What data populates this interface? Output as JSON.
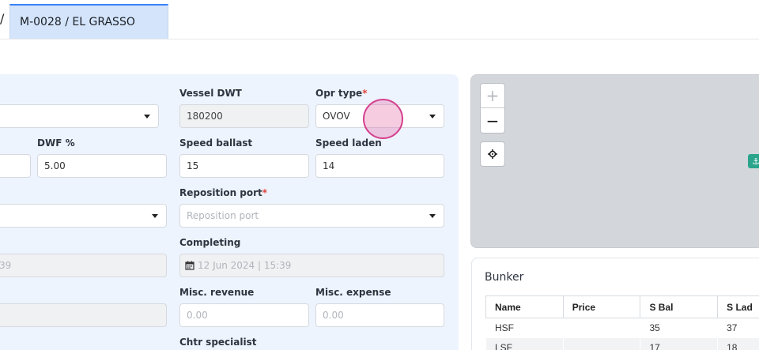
{
  "topbar": {
    "separator": "/",
    "active_tab": "M-0028 / EL GRASSO"
  },
  "form": {
    "vessel_dwt": {
      "label": "Vessel DWT",
      "value": "180200"
    },
    "opr_type": {
      "label": "Opr type",
      "required": "*",
      "value": "OVOV"
    },
    "dwf_pct": {
      "label": "DWF %",
      "value": "5.00"
    },
    "speed_ballast": {
      "label": "Speed ballast",
      "value": "15"
    },
    "speed_laden": {
      "label": "Speed laden",
      "value": "14"
    },
    "reposition_port": {
      "label": "Reposition port",
      "required": "*",
      "placeholder": "Reposition port"
    },
    "completing": {
      "label": "Completing",
      "value": "12 Jun 2024 | 15:39"
    },
    "left_date_partial": "39",
    "misc_revenue": {
      "label": "Misc. revenue",
      "placeholder": "0.00"
    },
    "misc_expense": {
      "label": "Misc. expense",
      "placeholder": "0.00"
    },
    "chtr_specialist": {
      "label": "Chtr specialist"
    }
  },
  "map": {
    "zoom_in": "+",
    "zoom_out": "−",
    "locate_icon": "crosshair-icon",
    "marker_icon": "anchor-icon",
    "marker_color": "#2aa58c"
  },
  "bunker": {
    "title": "Bunker",
    "columns": [
      "Name",
      "Price",
      "S Bal",
      "S Lad"
    ],
    "rows": [
      {
        "name": "HSF",
        "price": "",
        "s_bal": "35",
        "s_lad": "37"
      },
      {
        "name": "LSF",
        "price": "",
        "s_bal": "17",
        "s_lad": "18"
      }
    ]
  },
  "colors": {
    "accent": "#3b82f6",
    "tab_bg": "#d3e4fb",
    "form_bg": "#eef4fd",
    "required": "#e0453c"
  }
}
